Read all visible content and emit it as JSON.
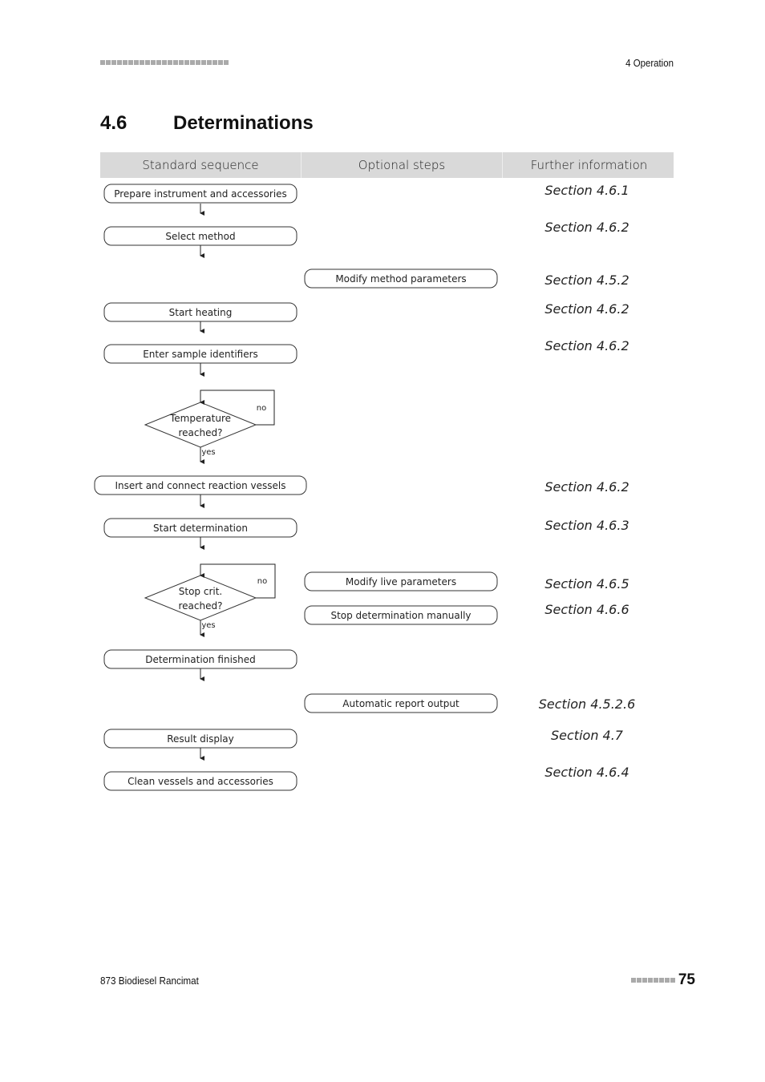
{
  "header": {
    "chapter": "4 Operation",
    "decor_squares": 23
  },
  "title": {
    "number": "4.6",
    "text": "Determinations"
  },
  "table_headers": [
    "Standard sequence",
    "Optional steps",
    "Further information"
  ],
  "standard_steps": [
    {
      "id": "prepare",
      "label": "Prepare instrument and accessories"
    },
    {
      "id": "select",
      "label": "Select method"
    },
    {
      "id": "heat",
      "label": "Start heating"
    },
    {
      "id": "enter",
      "label": "Enter sample identifiers"
    },
    {
      "id": "temp",
      "label": "Temperature reached?",
      "type": "decision",
      "no": "no",
      "yes": "yes"
    },
    {
      "id": "insert",
      "label": "Insert and connect reaction vessels"
    },
    {
      "id": "start",
      "label": "Start determination"
    },
    {
      "id": "stop",
      "label": "Stop crit. reached?",
      "type": "decision",
      "no": "no",
      "yes": "yes"
    },
    {
      "id": "finished",
      "label": "Determination finished"
    },
    {
      "id": "result",
      "label": "Result display"
    },
    {
      "id": "clean",
      "label": "Clean vessels and accessories"
    }
  ],
  "optional_steps": [
    {
      "id": "modify-method",
      "label": "Modify method parameters"
    },
    {
      "id": "modify-live",
      "label": "Modify live parameters"
    },
    {
      "id": "stop-manual",
      "label": "Stop determination manually"
    },
    {
      "id": "auto-report",
      "label": "Automatic report output"
    }
  ],
  "further_info": [
    "Section 4.6.1",
    "Section 4.6.2",
    "Section 4.5.2",
    "Section 4.6.2",
    "Section 4.6.2",
    "Section 4.6.2",
    "Section 4.6.3",
    "Section 4.6.5",
    "Section 4.6.6",
    "Section 4.5.2.6",
    "Section 4.7",
    "Section 4.6.4"
  ],
  "footer": {
    "product": "873 Biodiesel Rancimat",
    "page": "75",
    "decor_squares": 8
  }
}
